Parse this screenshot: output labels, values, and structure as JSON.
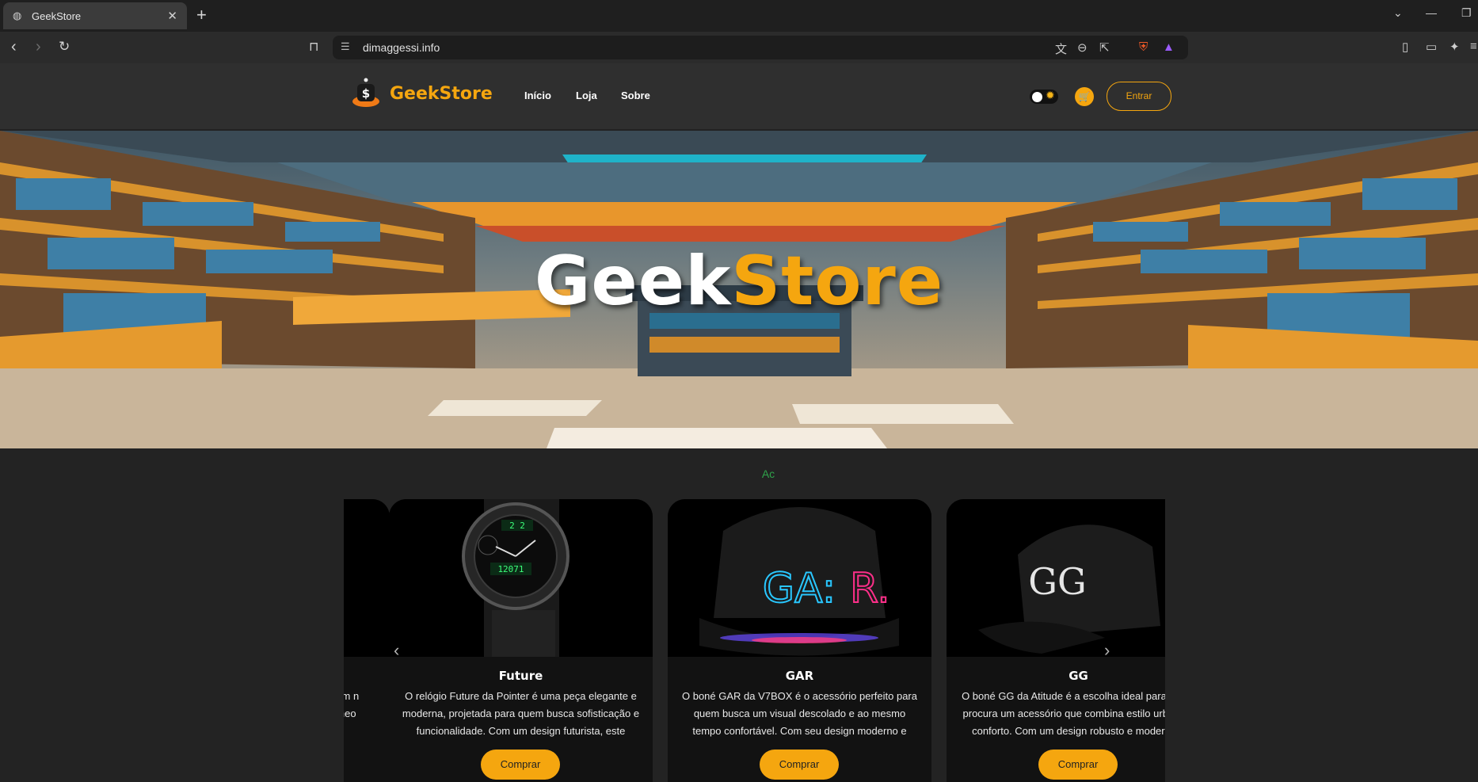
{
  "browser": {
    "tab_title": "GeekStore",
    "url": "dimaggessi.info"
  },
  "site": {
    "brand": "GeekStore",
    "nav": [
      "Início",
      "Loja",
      "Sobre"
    ],
    "login_label": "Entrar"
  },
  "hero": {
    "title_part1": "Geek",
    "title_part2": "Store"
  },
  "section_label": "Ac",
  "products": [
    {
      "name": "",
      "desc": "a quem n um âneo e..."
    },
    {
      "name": "Future",
      "desc": "O relógio Future da Pointer é uma peça elegante e moderna, projetada para quem busca sofisticação e funcionalidade. Com um design futurista, este relógio...",
      "buy_label": "Comprar"
    },
    {
      "name": "GAR",
      "desc": "O boné GAR da V7BOX é o acessório perfeito para quem busca um visual descolado e ao mesmo tempo confortável. Com seu design moderno e detalhado, es...",
      "buy_label": "Comprar"
    },
    {
      "name": "GG",
      "desc": "O boné GG da Atitude é a escolha ideal para quem procura um acessório que combina estilo urbano e conforto. Com um design robusto e moderno...",
      "buy_label": "Comprar"
    }
  ],
  "colors": {
    "accent": "#f5a60f",
    "label_green": "#2fa24a"
  }
}
